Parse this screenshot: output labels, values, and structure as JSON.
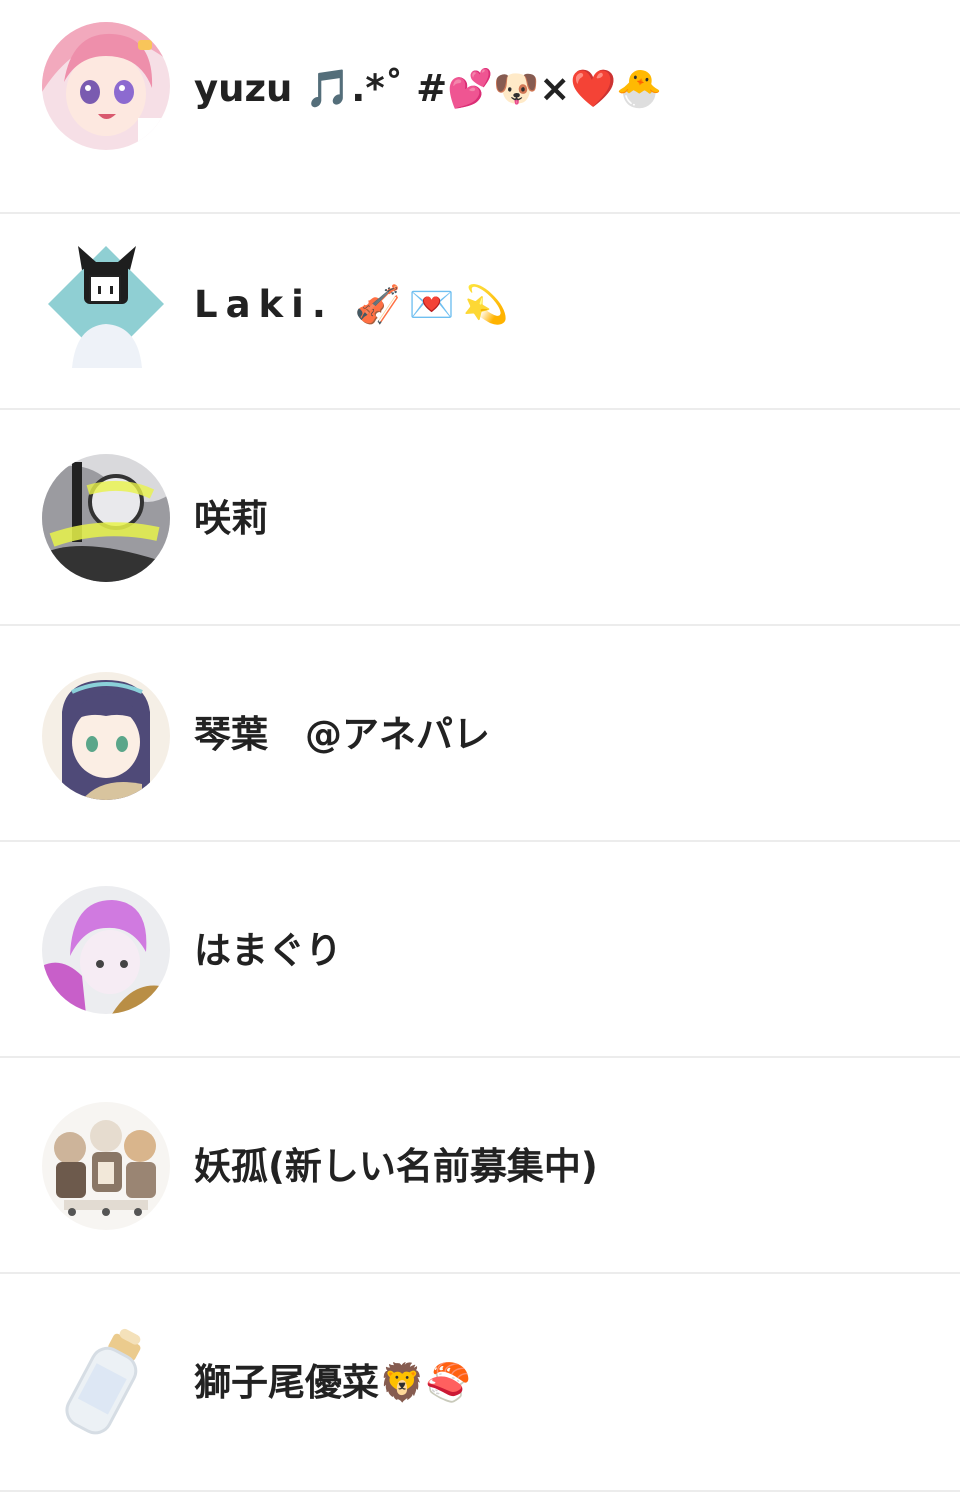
{
  "users": [
    {
      "name": "yuzu 🎵.*˚ #💕🐶×❤️🐣"
    },
    {
      "name": "Laki. 🎻💌💫"
    },
    {
      "name": "咲莉"
    },
    {
      "name": "琴葉　@アネパレ"
    },
    {
      "name": "はまぐり"
    },
    {
      "name": "妖孤(新しい名前募集中)"
    },
    {
      "name": "獅子尾優菜🦁🍣"
    }
  ],
  "colors": {
    "divider": "#ececec",
    "text": "#222222",
    "background": "#ffffff"
  }
}
